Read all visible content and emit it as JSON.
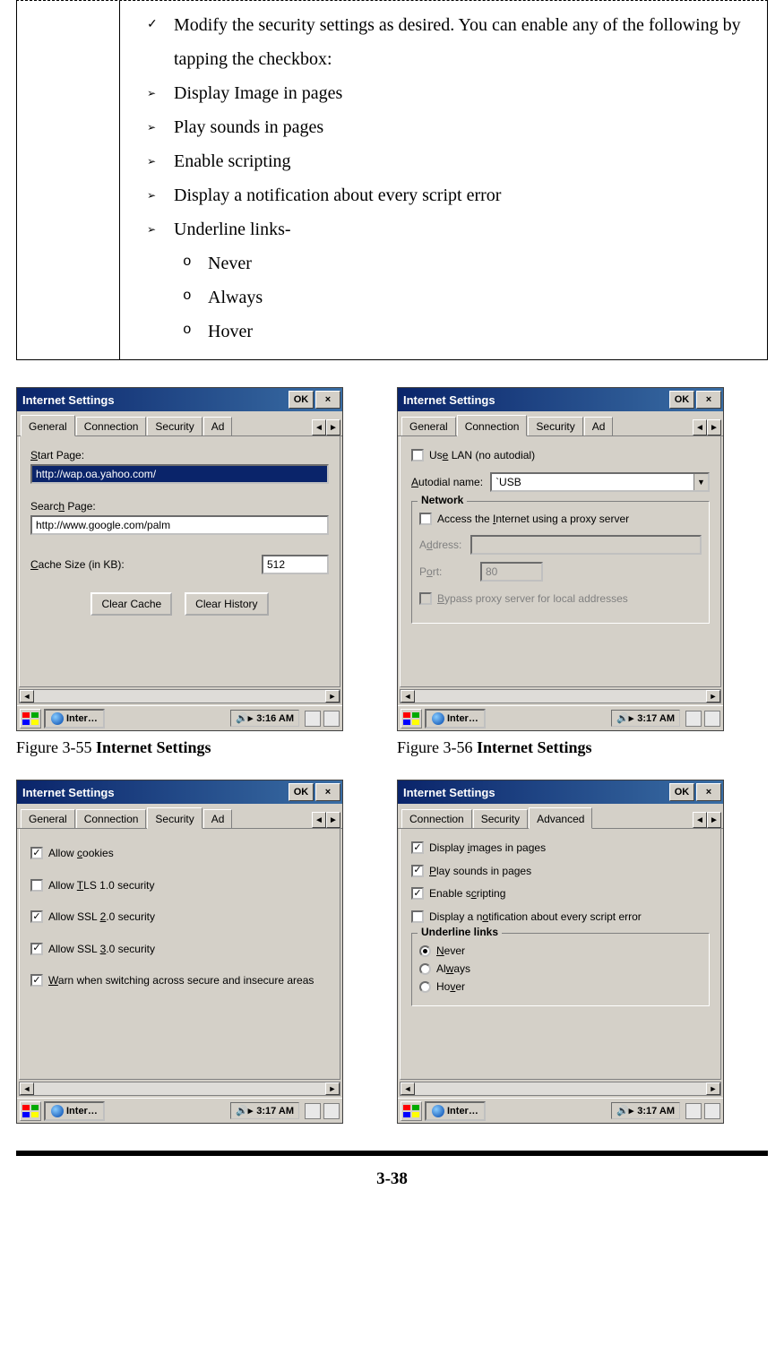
{
  "instructions": {
    "intro": "Modify the security settings as desired. You can enable any of the following by tapping the checkbox:",
    "items": [
      "Display Image in pages",
      "Play sounds in pages",
      "Enable scripting",
      "Display a notification about every script error",
      "Underline links-"
    ],
    "underline_options": [
      "Never",
      "Always",
      "Hover"
    ]
  },
  "screens": {
    "s1": {
      "title": "Internet Settings",
      "ok": "OK",
      "tabs": {
        "general": "General",
        "connection": "Connection",
        "security": "Security",
        "ad": "Ad"
      },
      "start_page_label": "Start Page:",
      "start_page": "http://wap.oa.yahoo.com/",
      "search_page_label": "Search Page:",
      "search_page": "http://www.google.com/palm",
      "cache_label": "Cache Size (in KB):",
      "cache": "512",
      "clear_cache": "Clear Cache",
      "clear_history": "Clear History",
      "task": "Inter…",
      "time": "3:16 AM"
    },
    "s2": {
      "title": "Internet Settings",
      "ok": "OK",
      "tabs": {
        "general": "General",
        "connection": "Connection",
        "security": "Security",
        "ad": "Ad"
      },
      "use_lan": "Use LAN (no autodial)",
      "autodial_label": "Autodial name:",
      "autodial": "`USB",
      "group": "Network",
      "proxy": "Access the Internet using a proxy server",
      "address_label": "Address:",
      "port_label": "Port:",
      "port": "80",
      "bypass": "Bypass proxy server for local addresses",
      "task": "Inter…",
      "time": "3:17 AM"
    },
    "s3": {
      "title": "Internet Settings",
      "ok": "OK",
      "tabs": {
        "general": "General",
        "connection": "Connection",
        "security": "Security",
        "ad": "Ad"
      },
      "cookies": "Allow cookies",
      "tls": "Allow TLS 1.0 security",
      "ssl2": "Allow SSL 2.0 security",
      "ssl3": "Allow SSL 3.0 security",
      "warn": "Warn when switching across secure and insecure areas",
      "task": "Inter…",
      "time": "3:17 AM"
    },
    "s4": {
      "title": "Internet Settings",
      "ok": "OK",
      "tabs": {
        "connection": "Connection",
        "security": "Security",
        "advanced": "Advanced"
      },
      "images": "Display images in pages",
      "sounds": "Play sounds in pages",
      "scripting": "Enable scripting",
      "notify": "Display a notification about every script error",
      "group": "Underline links",
      "never": "Never",
      "always": "Always",
      "hover": "Hover",
      "task": "Inter…",
      "time": "3:17 AM"
    }
  },
  "captions": {
    "c1_pre": "Figure 3-55 ",
    "c1_bold": "Internet Settings",
    "c2_pre": "Figure 3-56 ",
    "c2_bold": "Internet Settings"
  },
  "page_number": "3-38"
}
